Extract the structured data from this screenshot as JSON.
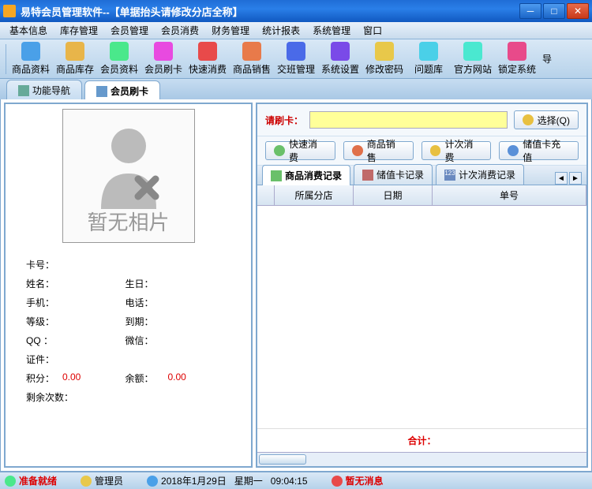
{
  "window": {
    "title": "易特会员管理软件--【单据抬头请修改分店全称】"
  },
  "menubar": [
    "基本信息",
    "库存管理",
    "会员管理",
    "会员消费",
    "财务管理",
    "统计报表",
    "系统管理",
    "窗口"
  ],
  "toolbar": [
    {
      "label": "商品资料",
      "color": "#4aa0e8"
    },
    {
      "label": "商品库存",
      "color": "#e8b54a"
    },
    {
      "label": "会员资料",
      "color": "#4ae88b"
    },
    {
      "label": "会员刷卡",
      "color": "#e84ae0"
    },
    {
      "label": "快速消费",
      "color": "#e84a4a"
    },
    {
      "label": "商品销售",
      "color": "#e87a4a"
    },
    {
      "label": "交班管理",
      "color": "#4a6ae8"
    },
    {
      "label": "系统设置",
      "color": "#7a4ae8"
    },
    {
      "label": "修改密码",
      "color": "#e8c84a"
    },
    {
      "label": "问题库",
      "color": "#4ad0e8"
    },
    {
      "label": "官方网站",
      "color": "#4ae8d0"
    },
    {
      "label": "锁定系统",
      "color": "#e84a8a"
    },
    {
      "label": "导",
      "color": "#888"
    }
  ],
  "tabs": {
    "inactive": "功能导航",
    "active": "会员刷卡"
  },
  "left": {
    "photo_caption": "暂无相片",
    "fields": {
      "card_no": "卡号：",
      "name": "姓名：",
      "birthday": "生日：",
      "mobile": "手机：",
      "phone": "电话：",
      "level": "等级：",
      "expire": "到期：",
      "qq": "QQ ：",
      "wechat": "微信：",
      "id": "证件：",
      "points": "积分：",
      "points_val": "0.00",
      "balance": "余额：",
      "balance_val": "0.00",
      "remain": "剩余次数："
    }
  },
  "right": {
    "swipe_label": "请刷卡：",
    "select_btn": "选择(Q)",
    "actions": [
      {
        "label": "快速消费",
        "color": "#6ac06a"
      },
      {
        "label": "商品销售",
        "color": "#e0704a"
      },
      {
        "label": "计次消费",
        "color": "#e8c040"
      },
      {
        "label": "储值卡充值",
        "color": "#5a90d8"
      }
    ],
    "subtabs": [
      "商品消费记录",
      "储值卡记录",
      "计次消费记录"
    ],
    "columns": [
      "所属分店",
      "日期",
      "单号"
    ],
    "total": "合计："
  },
  "status": {
    "ready": "准备就绪",
    "admin": "管理员",
    "date": "2018年1月29日",
    "weekday": "星期一",
    "time": "09:04:15",
    "msg": "暂无消息"
  }
}
